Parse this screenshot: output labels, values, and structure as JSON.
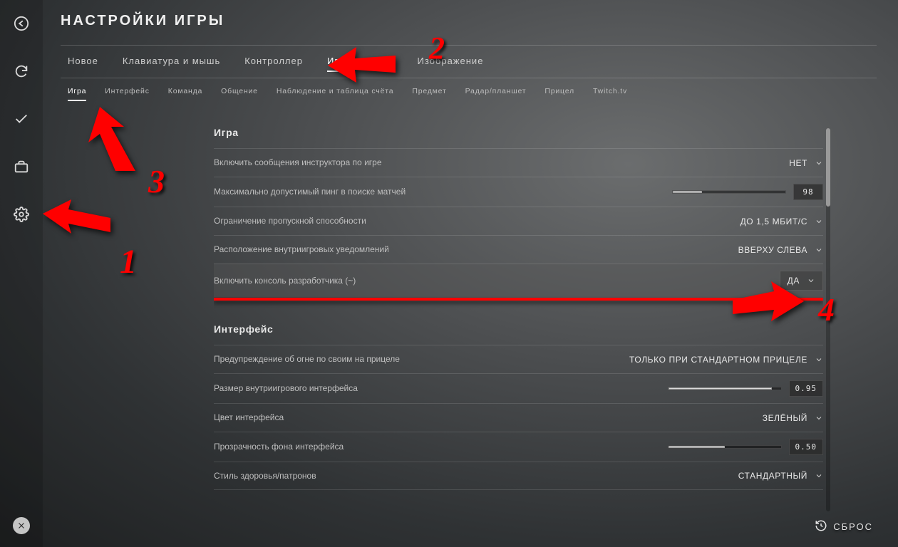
{
  "title": "НАСТРОЙКИ ИГРЫ",
  "primary_tabs": [
    {
      "label": "Новое"
    },
    {
      "label": "Клавиатура и мышь"
    },
    {
      "label": "Контроллер"
    },
    {
      "label": "Игра",
      "active": true
    },
    {
      "label": "Изображение"
    }
  ],
  "secondary_tabs": [
    {
      "label": "Игра",
      "active": true
    },
    {
      "label": "Интерфейс"
    },
    {
      "label": "Команда"
    },
    {
      "label": "Общение"
    },
    {
      "label": "Наблюдение и таблица счёта"
    },
    {
      "label": "Предмет"
    },
    {
      "label": "Радар/планшет"
    },
    {
      "label": "Прицел"
    },
    {
      "label": "Twitch.tv"
    }
  ],
  "sections": {
    "game": {
      "title": "Игра",
      "rows": {
        "instructor": {
          "label": "Включить сообщения инструктора по игре",
          "value": "НЕТ"
        },
        "ping": {
          "label": "Максимально допустимый пинг в поиске матчей",
          "value": "98",
          "slider_pct": 26
        },
        "bandwidth": {
          "label": "Ограничение пропускной способности",
          "value": "ДО 1,5 МБИТ/С"
        },
        "notif_pos": {
          "label": "Расположение внутриигровых уведомлений",
          "value": "ВВЕРХУ СЛЕВА"
        },
        "dev_console": {
          "label": "Включить консоль разработчика (~)",
          "value": "ДА"
        }
      }
    },
    "interface": {
      "title": "Интерфейс",
      "rows": {
        "friendly_fire": {
          "label": "Предупреждение об огне по своим на прицеле",
          "value": "ТОЛЬКО ПРИ СТАНДАРТНОМ ПРИЦЕЛЕ"
        },
        "hud_scale": {
          "label": "Размер внутриигрового интерфейса",
          "value": "0.95",
          "slider_pct": 92
        },
        "hud_color": {
          "label": "Цвет интерфейса",
          "value": "ЗЕЛЁНЫЙ"
        },
        "hud_alpha": {
          "label": "Прозрачность фона интерфейса",
          "value": "0.50",
          "slider_pct": 50
        },
        "health_style": {
          "label": "Стиль здоровья/патронов",
          "value": "СТАНДАРТНЫЙ"
        }
      }
    }
  },
  "reset_label": "СБРОС",
  "annotations": {
    "n1": "1",
    "n2": "2",
    "n3": "3",
    "n4": "4"
  }
}
